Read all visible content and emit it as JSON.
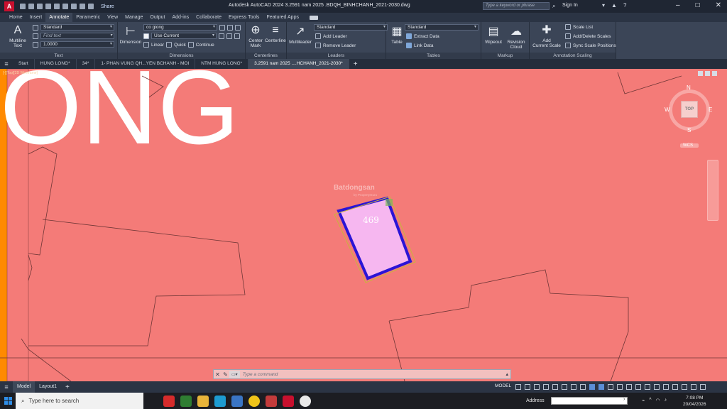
{
  "titlebar": {
    "logo": "A",
    "share": "Share",
    "title": "Autodesk AutoCAD 2024   3.2591 nam 2025 .BDQH_BINHCHANH_2021-2030.dwg",
    "search_placeholder": "Type a keyword or phrase",
    "signin": "Sign In"
  },
  "ribbon_tabs": [
    "Home",
    "Insert",
    "Annotate",
    "Parametric",
    "View",
    "Manage",
    "Output",
    "Add-ins",
    "Collaborate",
    "Express Tools",
    "Featured Apps"
  ],
  "ribbon": {
    "text": {
      "multiline": "Multiline",
      "multiline2": "Text",
      "style": "Standard",
      "find": "Find text",
      "height": "1.0000",
      "title": "Text"
    },
    "dimensions": {
      "dimension": "Dimension",
      "dimstyle": "co giong",
      "layer": "Use Current",
      "linear": "Linear",
      "quick": "Quick",
      "continue": "Continue",
      "title": "Dimensions"
    },
    "centerlines": {
      "center_mark": "Center",
      "center_mark2": "Mark",
      "centerline": "Centerline",
      "title": "Centerlines"
    },
    "leaders": {
      "multileader": "Multileader",
      "style": "Standard",
      "add": "Add Leader",
      "remove": "Remove Leader",
      "title": "Leaders"
    },
    "tables": {
      "table": "Table",
      "style": "Standard",
      "extract": "Extract Data",
      "link": "Link Data",
      "title": "Tables"
    },
    "markup": {
      "wipeout": "Wipeout",
      "revision": "Revision",
      "revision2": "Cloud",
      "title": "Markup"
    },
    "scaling": {
      "add_scale": "Add",
      "add_scale2": "Current Scale",
      "scale_list": "Scale List",
      "add_delete": "Add/Delete Scales",
      "sync": "Sync Scale Positions",
      "title": "Annotation Scaling"
    }
  },
  "doc_tabs": [
    "Start",
    "HUNG LONG*",
    "34*",
    "1- PHAN VUNG QH...YEN BCHANH - MOI",
    "NTM HUNG LONG*",
    "3.2591 nam 2025 ....HCHANH_2021-2030*"
  ],
  "canvas": {
    "viewport_label": "[-][Top][2D Wireframe]",
    "big_text": "ONG",
    "parcel_number": "469",
    "watermark": "Batdongsan",
    "watermark_sub": "by PropertyGuru",
    "viewcube": {
      "top": "TOP",
      "n": "N",
      "s": "S",
      "e": "E",
      "w": "W",
      "wcs": "WCS"
    },
    "background_color": "#f47b78",
    "parcel_color": "#2b14d6"
  },
  "command": {
    "placeholder": "Type a command"
  },
  "status": {
    "layouts": [
      "Model",
      "Layout1"
    ],
    "model_button": "MODEL",
    "watermark": "Batdongsan",
    "watermark_sub": "by PropertyGuru"
  },
  "taskbar": {
    "search": "Type here to search",
    "address_label": "Address",
    "time": "7:08 PM",
    "date": "20/04/2026"
  }
}
